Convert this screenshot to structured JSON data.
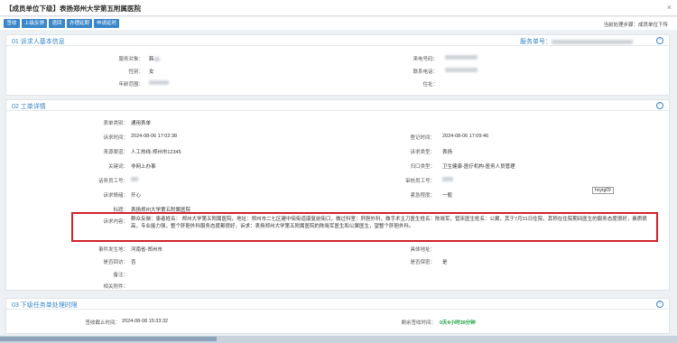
{
  "window": {
    "title": "【成员单位下级】表扬郑州大学第五附属医院",
    "close_label": "×"
  },
  "toolbar": {
    "buttons": [
      "签收",
      "上级反馈",
      "退回",
      "办理延期",
      "申请延时"
    ],
    "status_label": "当前处理步骤：成员单位下传"
  },
  "section1": {
    "title": "01 诉求人基本信息",
    "service_label": "服务单号：",
    "fields": {
      "service_object_label": "服务对象：",
      "service_object_value": "韩",
      "gender_label": "性别：",
      "gender_value": "女",
      "age_label": "年龄范围：",
      "caller_label": "来电号码：",
      "phone_label": "联系电话：",
      "address_label": "住址："
    }
  },
  "section2": {
    "title": "02 工单详情",
    "fields": {
      "category_label": "表单类别：",
      "category_value": "通用表单",
      "appeal_time_label": "诉求时间：",
      "appeal_time_value": "2024-08-06 17:02:38",
      "register_time_label": "登记时间：",
      "register_time_value": "2024-08-06 17:09:46",
      "source_label": "来源渠道：",
      "source_value": "人工热线-郑州市12345",
      "appeal_type_label": "诉求类型：",
      "appeal_type_value": "表扬",
      "keyword_label": "关键词：",
      "keyword_value": "非网上办事",
      "category2_label": "归口类型：",
      "category2_value": "卫生健康-医疗机构-医务人员管理",
      "agent_label": "话务员工号：",
      "reviewer_label": "审核员工号：",
      "emotion_label": "诉求情绪：",
      "emotion_value": "开心",
      "urgency_label": "紧急程度：",
      "urgency_value": "一般",
      "subject_label": "标题：",
      "subject_value": "表扬郑州大学第五附属医院",
      "content_label": "诉求内容：",
      "content_value": "群众反映：患者姓名：        郑州大学第五附属医院，地址：郑州市二七区建中街街道康复前街口，做过科室：肝胆外科，做手术主刀医生姓名：陈晓军，管床医生姓名：公翼，其于7月31日住院，其称在住院期间医生的服务态度很好，素质很高，专业能力强，整个肝胆外科服务态度都很好。诉求：表扬郑州大学第五附属医院的陈晓军医生和公翼医生，望整个肝胆外科。",
      "location_label": "事件发生地：",
      "location_value": "河南省-郑州市",
      "detail_address_label": "具体地址：",
      "return_visit_label": "是否回访：",
      "return_visit_value": "否",
      "confidential_label": "是否保密：",
      "confidential_value": "是",
      "remark_label": "备注：",
      "attachment_label": "相关附件："
    },
    "tooltip": "hnytg09"
  },
  "section3": {
    "title": "03 下级任务单处理时限",
    "deadline_label": "签收截止时间：",
    "deadline_value": "2024-08-08 15:33:32",
    "remaining_label": "剩余签收时间：",
    "remaining_value": "0天4小时39分钟"
  }
}
